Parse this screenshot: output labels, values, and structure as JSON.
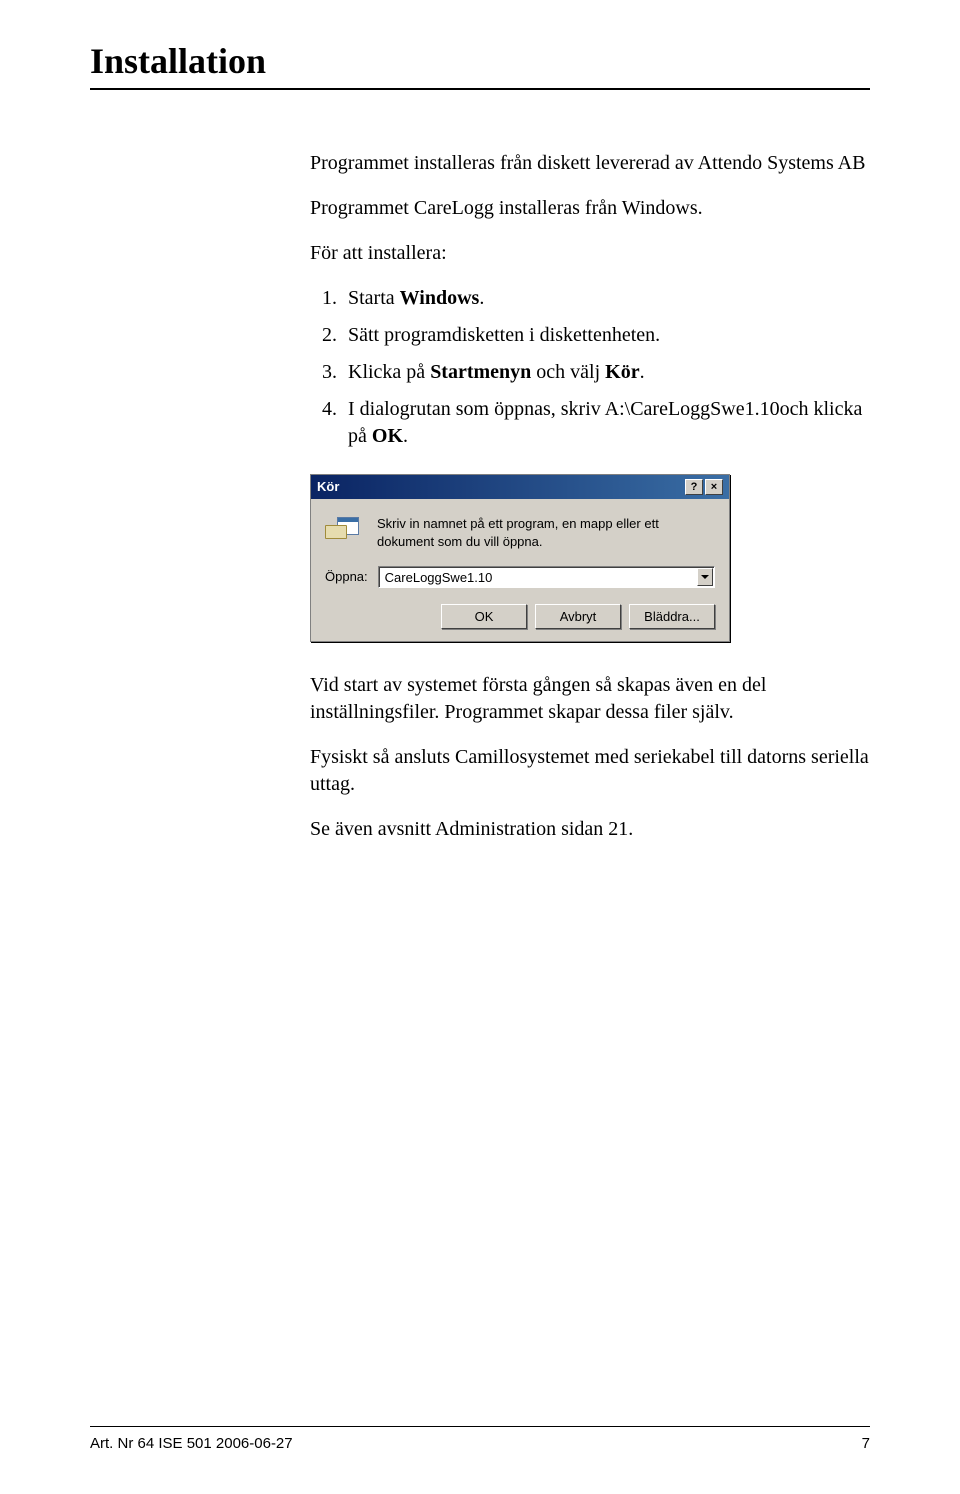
{
  "heading": "Installation",
  "intro": [
    "Programmet installeras från diskett levererad av Attendo Systems AB",
    "Programmet CareLogg installeras från Windows.",
    "För att installera:"
  ],
  "steps": [
    {
      "prefix": "Starta ",
      "bold": "Windows",
      "suffix": "."
    },
    {
      "prefix": "Sätt programdisketten i diskettenheten.",
      "bold": "",
      "suffix": ""
    },
    {
      "prefix": "Klicka på ",
      "bold": "Startmenyn",
      "mid": " och välj ",
      "bold2": "Kör",
      "suffix": "."
    },
    {
      "prefix": "I dialogrutan som öppnas, skriv A:\\CareLoggSwe1.10och klicka på ",
      "bold": "OK",
      "suffix": "."
    }
  ],
  "dialog": {
    "title": "Kör",
    "help_btn": "?",
    "close_btn": "×",
    "description": "Skriv in namnet på ett program, en mapp eller ett\ndokument som du vill öppna.",
    "open_label": "Öppna:",
    "open_value": "CareLoggSwe1.10",
    "buttons": {
      "ok": "OK",
      "cancel": "Avbryt",
      "browse": "Bläddra..."
    }
  },
  "post": [
    "Vid start av systemet första gången så skapas även en del inställningsfiler. Programmet skapar dessa filer själv.",
    "Fysiskt så ansluts Camillosystemet med seriekabel till datorns seriella uttag.",
    "Se även avsnitt Administration sidan 21."
  ],
  "footer": {
    "left": "Art. Nr 64 ISE 501  2006-06-27",
    "right": "7"
  }
}
